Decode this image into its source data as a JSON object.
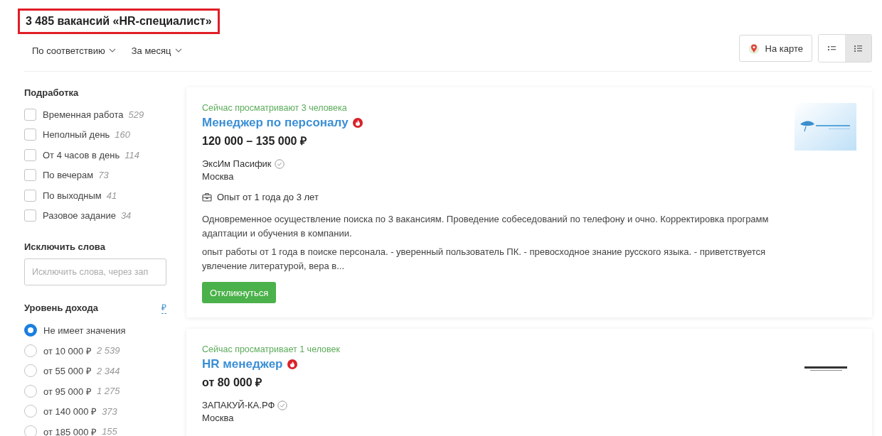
{
  "header": {
    "title": "3 485 вакансий «HR-специалист»",
    "highlighted": true
  },
  "sort": [
    {
      "label": "По соответствию"
    },
    {
      "label": "За месяц"
    }
  ],
  "map_button": {
    "label": "На карте"
  },
  "view_toggle": [
    {
      "selected": false
    },
    {
      "selected": true
    }
  ],
  "filters": {
    "part_time": {
      "title": "Подработка",
      "options": [
        {
          "label": "Временная работа",
          "count": "529",
          "checked": false
        },
        {
          "label": "Неполный день",
          "count": "160",
          "checked": false
        },
        {
          "label": "От 4 часов в день",
          "count": "114",
          "checked": false
        },
        {
          "label": "По вечерам",
          "count": "73",
          "checked": false
        },
        {
          "label": "По выходным",
          "count": "41",
          "checked": false
        },
        {
          "label": "Разовое задание",
          "count": "34",
          "checked": false
        }
      ]
    },
    "exclude_words": {
      "title": "Исключить слова",
      "placeholder": "Исключить слова, через зап"
    },
    "income": {
      "title": "Уровень дохода",
      "currency": "₽",
      "options": [
        {
          "label": "Не имеет значения",
          "selected": true
        },
        {
          "label": "от 10 000 ₽",
          "count": "2 539",
          "selected": false
        },
        {
          "label": "от 55 000 ₽",
          "count": "2 344",
          "selected": false
        },
        {
          "label": "от 95 000 ₽",
          "count": "1 275",
          "selected": false
        },
        {
          "label": "от 140 000 ₽",
          "count": "373",
          "selected": false
        },
        {
          "label": "от 185 000 ₽",
          "count": "155",
          "selected": false
        }
      ]
    }
  },
  "vacancies": [
    {
      "viewers": "Сейчас просматривают 3 человека",
      "title": "Менеджер по персоналу",
      "hot": true,
      "salary": "120 000 – 135 000 ₽",
      "company": "ЭксИм Пасифик",
      "verified": true,
      "city": "Москва",
      "experience": "Опыт от 1 года до 3 лет",
      "responsibilities": "Одновременное осуществление поиска по 3 вакансиям. Проведение собеседований по телефону и очно. Корректировка программ адаптации и обучения в компании.",
      "requirements": "опыт работы от 1 года в поиске персонала. - уверенный пользователь ПК. - превосходное знание русского языка. - приветствуется увлечение литературой, вера в...",
      "button": "Откликнуться"
    },
    {
      "viewers": "Сейчас просматривает 1 человек",
      "title": "HR менеджер",
      "hot": true,
      "salary": "от 80 000 ₽",
      "company": "ЗАПАКУЙ-КА.РФ",
      "verified": true,
      "city": "Москва"
    }
  ]
}
